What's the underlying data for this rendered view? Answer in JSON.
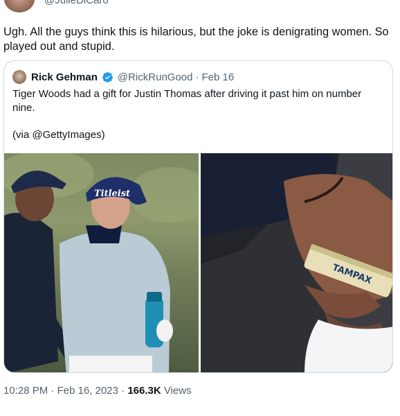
{
  "author": {
    "handle": "@JulieDiCaro"
  },
  "tweet": {
    "text": "Ugh. All the guys think this is hilarious, but the joke is denigrating women. So played out and stupid."
  },
  "quoted": {
    "name": "Rick Gehman",
    "handle": "@RickRunGood",
    "separator": "·",
    "date": "Feb 16",
    "text": "Tiger Woods had a gift for Justin Thomas after driving it past him on number nine.",
    "via": "(via @GettyImages)",
    "cap_left": "Titleist",
    "package_text": "TAMPAX"
  },
  "meta": {
    "time": "10:28 PM",
    "separator": "·",
    "date": "Feb 16, 2023",
    "separator2": "·",
    "views_count": "166.3K",
    "views_label": "Views"
  },
  "colors": {
    "verified": "#1d9bf0",
    "secondary_text": "#536471",
    "border": "#cfd9de"
  }
}
